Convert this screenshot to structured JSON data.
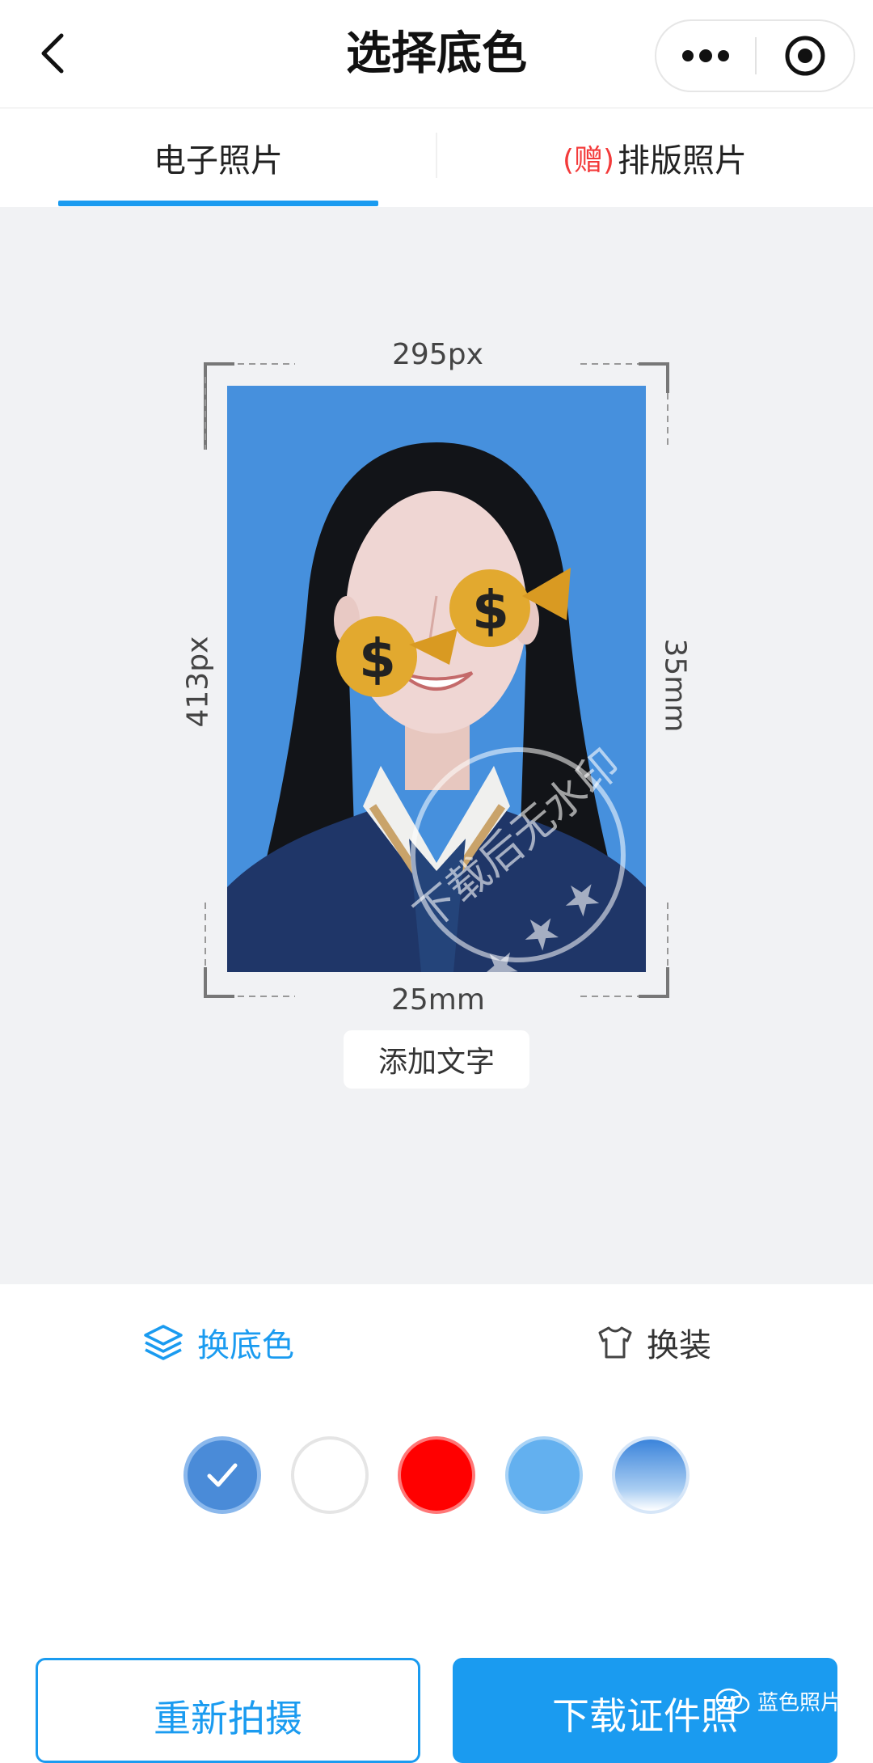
{
  "header": {
    "title": "选择底色",
    "back_icon": "chevron-left-icon",
    "more_icon": "more-dots-icon",
    "close_icon": "target-close-icon"
  },
  "tabs": [
    {
      "label": "电子照片",
      "active": true
    },
    {
      "gift_tag": "(赠)",
      "label": "排版照片",
      "active": false
    }
  ],
  "photo": {
    "width_px": "295px",
    "height_px": "413px",
    "width_mm": "25mm",
    "height_mm": "35mm",
    "background_color": "#4690dd",
    "watermark_text": "下载后无水印"
  },
  "add_text_label": "添加文字",
  "modes": [
    {
      "label": "换底色",
      "icon": "layers-icon",
      "active": true
    },
    {
      "label": "换装",
      "icon": "shirt-icon",
      "active": false
    }
  ],
  "swatches": [
    {
      "name": "blue",
      "color": "#4690dd",
      "selected": true
    },
    {
      "name": "white",
      "color": "#ffffff",
      "selected": false
    },
    {
      "name": "red",
      "color": "#ff0000",
      "selected": false
    },
    {
      "name": "light-blue",
      "color": "#63b0ef",
      "selected": false
    },
    {
      "name": "gradient-blue",
      "color": "#4a8fde",
      "selected": false
    }
  ],
  "actions": {
    "retake_label": "重新拍摄",
    "download_label": "下载证件照"
  },
  "watermark_badge": {
    "icon": "wechat-icon",
    "text": "蓝色照片"
  },
  "colors": {
    "accent": "#1a9bf0",
    "gift_red": "#f33a3a",
    "preview_bg": "#f1f2f4"
  }
}
